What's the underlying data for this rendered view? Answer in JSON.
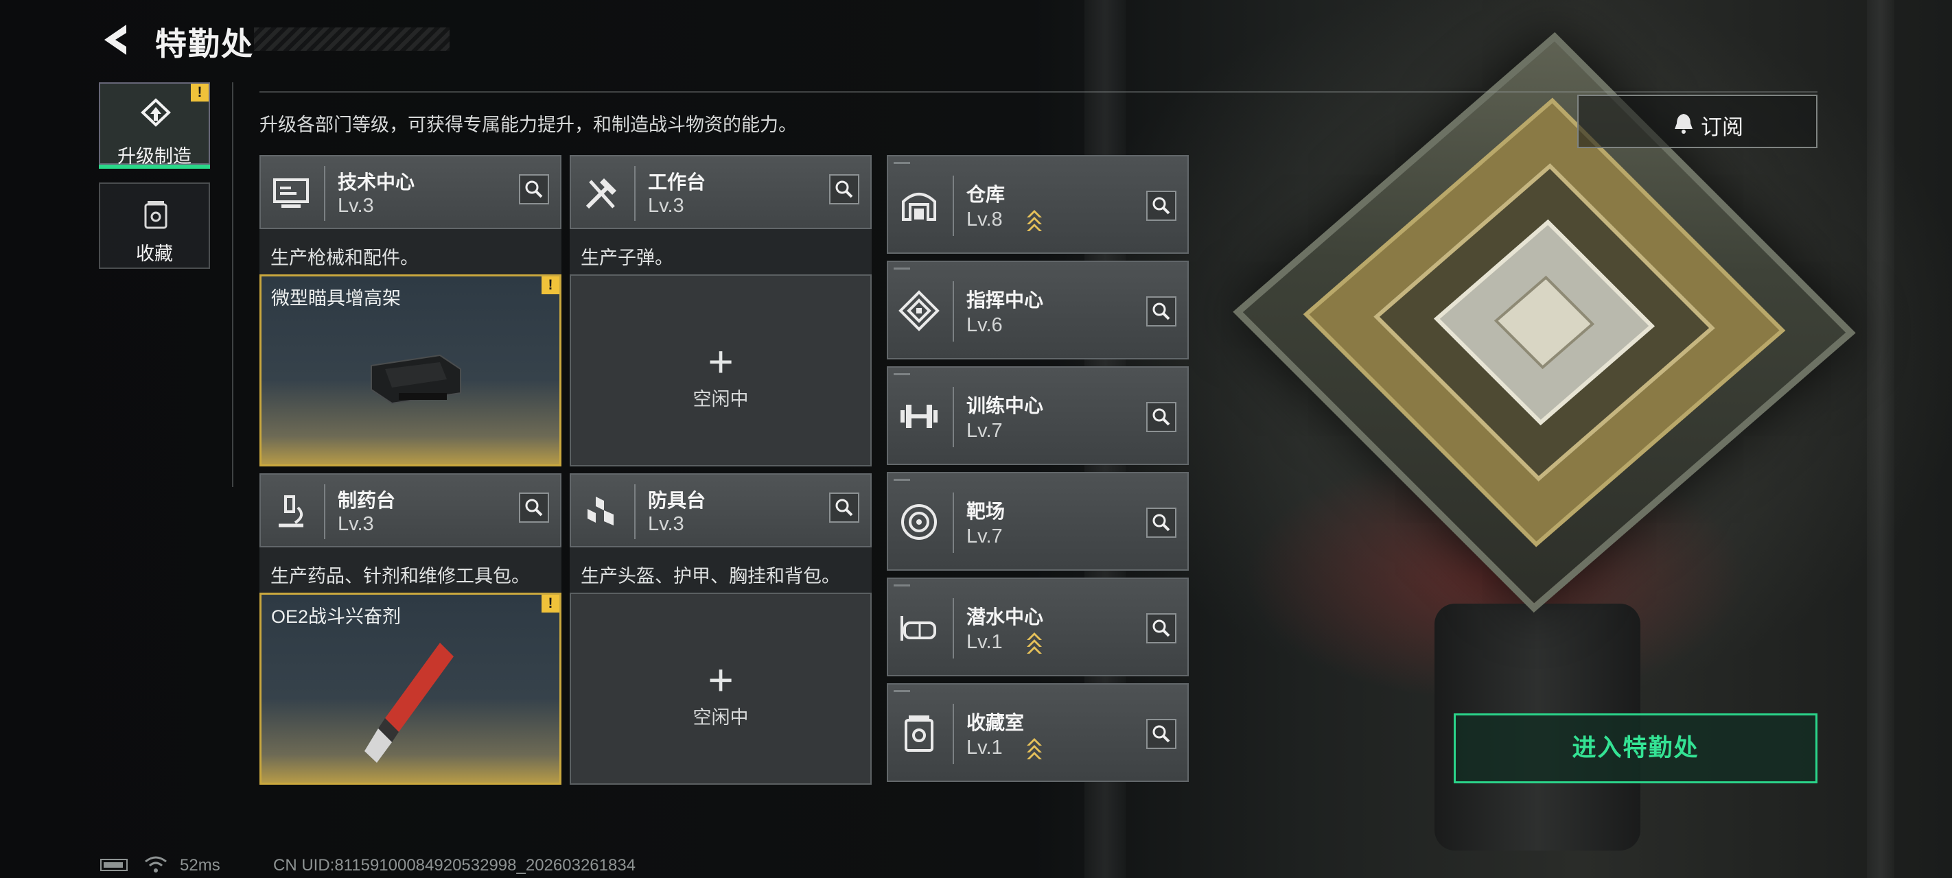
{
  "header": {
    "title": "特勤处"
  },
  "nav": {
    "tabs": [
      {
        "label": "升级制造",
        "active": true,
        "warning": "!"
      },
      {
        "label": "收藏",
        "active": false
      }
    ]
  },
  "intro": "升级各部门等级，可获得专属能力提升，和制造战斗物资的能力。",
  "subscribe_label": "订阅",
  "stations": [
    {
      "name": "技术中心",
      "level": "Lv.3",
      "desc": "生产枪械和配件。",
      "status": "busy",
      "item": "微型瞄具增高架",
      "warning": "!",
      "icon": "monitor-icon"
    },
    {
      "name": "工作台",
      "level": "Lv.3",
      "desc": "生产子弹。",
      "status": "idle",
      "idle_text": "空闲中",
      "plus": "+",
      "icon": "tools-icon"
    },
    {
      "name": "制药台",
      "level": "Lv.3",
      "desc": "生产药品、针剂和维修工具包。",
      "status": "busy",
      "item": "OE2战斗兴奋剂",
      "warning": "!",
      "icon": "microscope-icon"
    },
    {
      "name": "防具台",
      "level": "Lv.3",
      "desc": "生产头盔、护甲、胸挂和背包。",
      "status": "idle",
      "idle_text": "空闲中",
      "plus": "+",
      "icon": "cubes-icon"
    }
  ],
  "facilities": [
    {
      "name": "仓库",
      "level": "Lv.8",
      "upgradable": true,
      "icon": "warehouse-icon"
    },
    {
      "name": "指挥中心",
      "level": "Lv.6",
      "upgradable": false,
      "icon": "command-icon"
    },
    {
      "name": "训练中心",
      "level": "Lv.7",
      "upgradable": false,
      "icon": "dumbbell-icon"
    },
    {
      "name": "靶场",
      "level": "Lv.7",
      "upgradable": false,
      "icon": "target-icon"
    },
    {
      "name": "潜水中心",
      "level": "Lv.1",
      "upgradable": true,
      "icon": "diving-mask-icon"
    },
    {
      "name": "收藏室",
      "level": "Lv.1",
      "upgradable": true,
      "icon": "collection-icon"
    }
  ],
  "enter_button": "进入特勤处",
  "status_bar": {
    "ping": "52ms",
    "uid": "CN UID:81159100084920532998_202603261834"
  },
  "colors": {
    "accent": "#2ad889",
    "warning": "#f0c23a",
    "upgrade_arrow": "#e6c15a",
    "busy_border": "#caa83e"
  }
}
